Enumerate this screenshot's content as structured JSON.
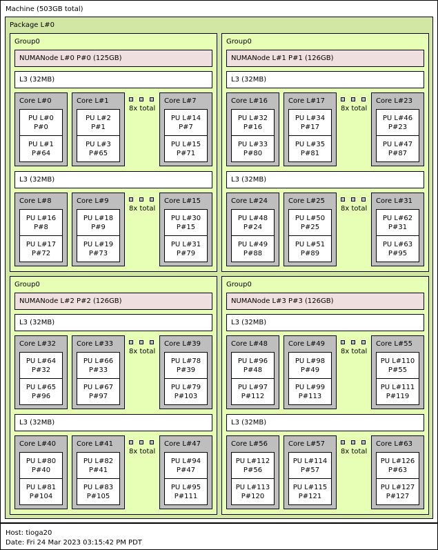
{
  "machine_label": "Machine (503GB total)",
  "package_label": "Package L#0",
  "group_label": "Group0",
  "l3_label": "L3 (32MB)",
  "more_label": "8x total",
  "numa_labels": [
    "NUMANode L#0 P#0 (125GB)",
    "NUMANode L#1 P#1 (126GB)",
    "NUMANode L#2 P#2 (126GB)",
    "NUMANode L#3 P#3 (126GB)"
  ],
  "cores": [
    {
      "label": "Core L#0",
      "pu1": [
        "PU L#0",
        "P#0"
      ],
      "pu2": [
        "PU L#1",
        "P#64"
      ]
    },
    {
      "label": "Core L#1",
      "pu1": [
        "PU L#2",
        "P#1"
      ],
      "pu2": [
        "PU L#3",
        "P#65"
      ]
    },
    {
      "label": "Core L#7",
      "pu1": [
        "PU L#14",
        "P#7"
      ],
      "pu2": [
        "PU L#15",
        "P#71"
      ]
    },
    {
      "label": "Core L#8",
      "pu1": [
        "PU L#16",
        "P#8"
      ],
      "pu2": [
        "PU L#17",
        "P#72"
      ]
    },
    {
      "label": "Core L#9",
      "pu1": [
        "PU L#18",
        "P#9"
      ],
      "pu2": [
        "PU L#19",
        "P#73"
      ]
    },
    {
      "label": "Core L#15",
      "pu1": [
        "PU L#30",
        "P#15"
      ],
      "pu2": [
        "PU L#31",
        "P#79"
      ]
    },
    {
      "label": "Core L#16",
      "pu1": [
        "PU L#32",
        "P#16"
      ],
      "pu2": [
        "PU L#33",
        "P#80"
      ]
    },
    {
      "label": "Core L#17",
      "pu1": [
        "PU L#34",
        "P#17"
      ],
      "pu2": [
        "PU L#35",
        "P#81"
      ]
    },
    {
      "label": "Core L#23",
      "pu1": [
        "PU L#46",
        "P#23"
      ],
      "pu2": [
        "PU L#47",
        "P#87"
      ]
    },
    {
      "label": "Core L#24",
      "pu1": [
        "PU L#48",
        "P#24"
      ],
      "pu2": [
        "PU L#49",
        "P#88"
      ]
    },
    {
      "label": "Core L#25",
      "pu1": [
        "PU L#50",
        "P#25"
      ],
      "pu2": [
        "PU L#51",
        "P#89"
      ]
    },
    {
      "label": "Core L#31",
      "pu1": [
        "PU L#62",
        "P#31"
      ],
      "pu2": [
        "PU L#63",
        "P#95"
      ]
    },
    {
      "label": "Core L#32",
      "pu1": [
        "PU L#64",
        "P#32"
      ],
      "pu2": [
        "PU L#65",
        "P#96"
      ]
    },
    {
      "label": "Core L#33",
      "pu1": [
        "PU L#66",
        "P#33"
      ],
      "pu2": [
        "PU L#67",
        "P#97"
      ]
    },
    {
      "label": "Core L#39",
      "pu1": [
        "PU L#78",
        "P#39"
      ],
      "pu2": [
        "PU L#79",
        "P#103"
      ]
    },
    {
      "label": "Core L#40",
      "pu1": [
        "PU L#80",
        "P#40"
      ],
      "pu2": [
        "PU L#81",
        "P#104"
      ]
    },
    {
      "label": "Core L#41",
      "pu1": [
        "PU L#82",
        "P#41"
      ],
      "pu2": [
        "PU L#83",
        "P#105"
      ]
    },
    {
      "label": "Core L#47",
      "pu1": [
        "PU L#94",
        "P#47"
      ],
      "pu2": [
        "PU L#95",
        "P#111"
      ]
    },
    {
      "label": "Core L#48",
      "pu1": [
        "PU L#96",
        "P#48"
      ],
      "pu2": [
        "PU L#97",
        "P#112"
      ]
    },
    {
      "label": "Core L#49",
      "pu1": [
        "PU L#98",
        "P#49"
      ],
      "pu2": [
        "PU L#99",
        "P#113"
      ]
    },
    {
      "label": "Core L#55",
      "pu1": [
        "PU L#110",
        "P#55"
      ],
      "pu2": [
        "PU L#111",
        "P#119"
      ]
    },
    {
      "label": "Core L#56",
      "pu1": [
        "PU L#112",
        "P#56"
      ],
      "pu2": [
        "PU L#113",
        "P#120"
      ]
    },
    {
      "label": "Core L#57",
      "pu1": [
        "PU L#114",
        "P#57"
      ],
      "pu2": [
        "PU L#115",
        "P#121"
      ]
    },
    {
      "label": "Core L#63",
      "pu1": [
        "PU L#126",
        "P#63"
      ],
      "pu2": [
        "PU L#127",
        "P#127"
      ]
    }
  ],
  "footer": {
    "host": "Host: tioga20",
    "date": "Date: Fri 24 Mar 2023 03:15:42 PM PDT"
  }
}
